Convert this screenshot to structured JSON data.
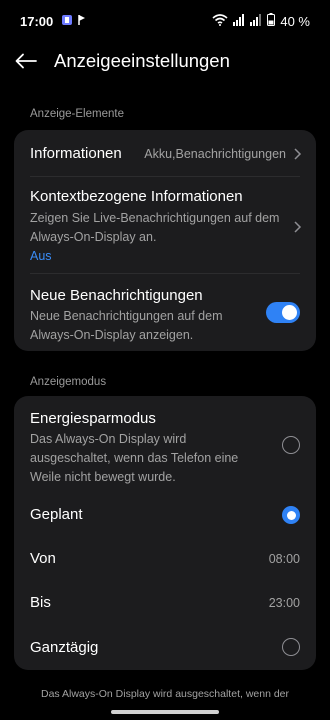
{
  "status_bar": {
    "time": "17:00",
    "battery": "40 %"
  },
  "header": {
    "title": "Anzeigeeinstellungen"
  },
  "sections": {
    "elements_label": "Anzeige-Elemente",
    "mode_label": "Anzeigemodus"
  },
  "elements": {
    "informationen": {
      "title": "Informationen",
      "value": "Akku,Benachrichtigungen"
    },
    "kontext": {
      "title": "Kontextbezogene Informationen",
      "sub1": "Zeigen Sie Live-Benachrichtigungen auf dem",
      "sub2": "Always-On-Display an.",
      "state": "Aus"
    },
    "neue": {
      "title": "Neue Benachrichtigungen",
      "sub1": "Neue Benachrichtigungen auf dem",
      "sub2": "Always-On-Display anzeigen.",
      "toggle_on": true
    }
  },
  "mode": {
    "energie": {
      "title": "Energiesparmodus",
      "sub1": "Das Always-On Display wird",
      "sub2": "ausgeschaltet, wenn das Telefon eine",
      "sub3": "Weile nicht bewegt wurde.",
      "selected": false
    },
    "geplant": {
      "title": "Geplant",
      "selected": true
    },
    "von": {
      "label": "Von",
      "value": "08:00"
    },
    "bis": {
      "label": "Bis",
      "value": "23:00"
    },
    "ganztaegig": {
      "title": "Ganztägig",
      "selected": false
    }
  },
  "footer": {
    "text": "Das Always-On Display wird ausgeschaltet, wenn der"
  },
  "colors": {
    "accent": "#2f82f5",
    "card": "#1c1c1e",
    "background": "#000000"
  }
}
